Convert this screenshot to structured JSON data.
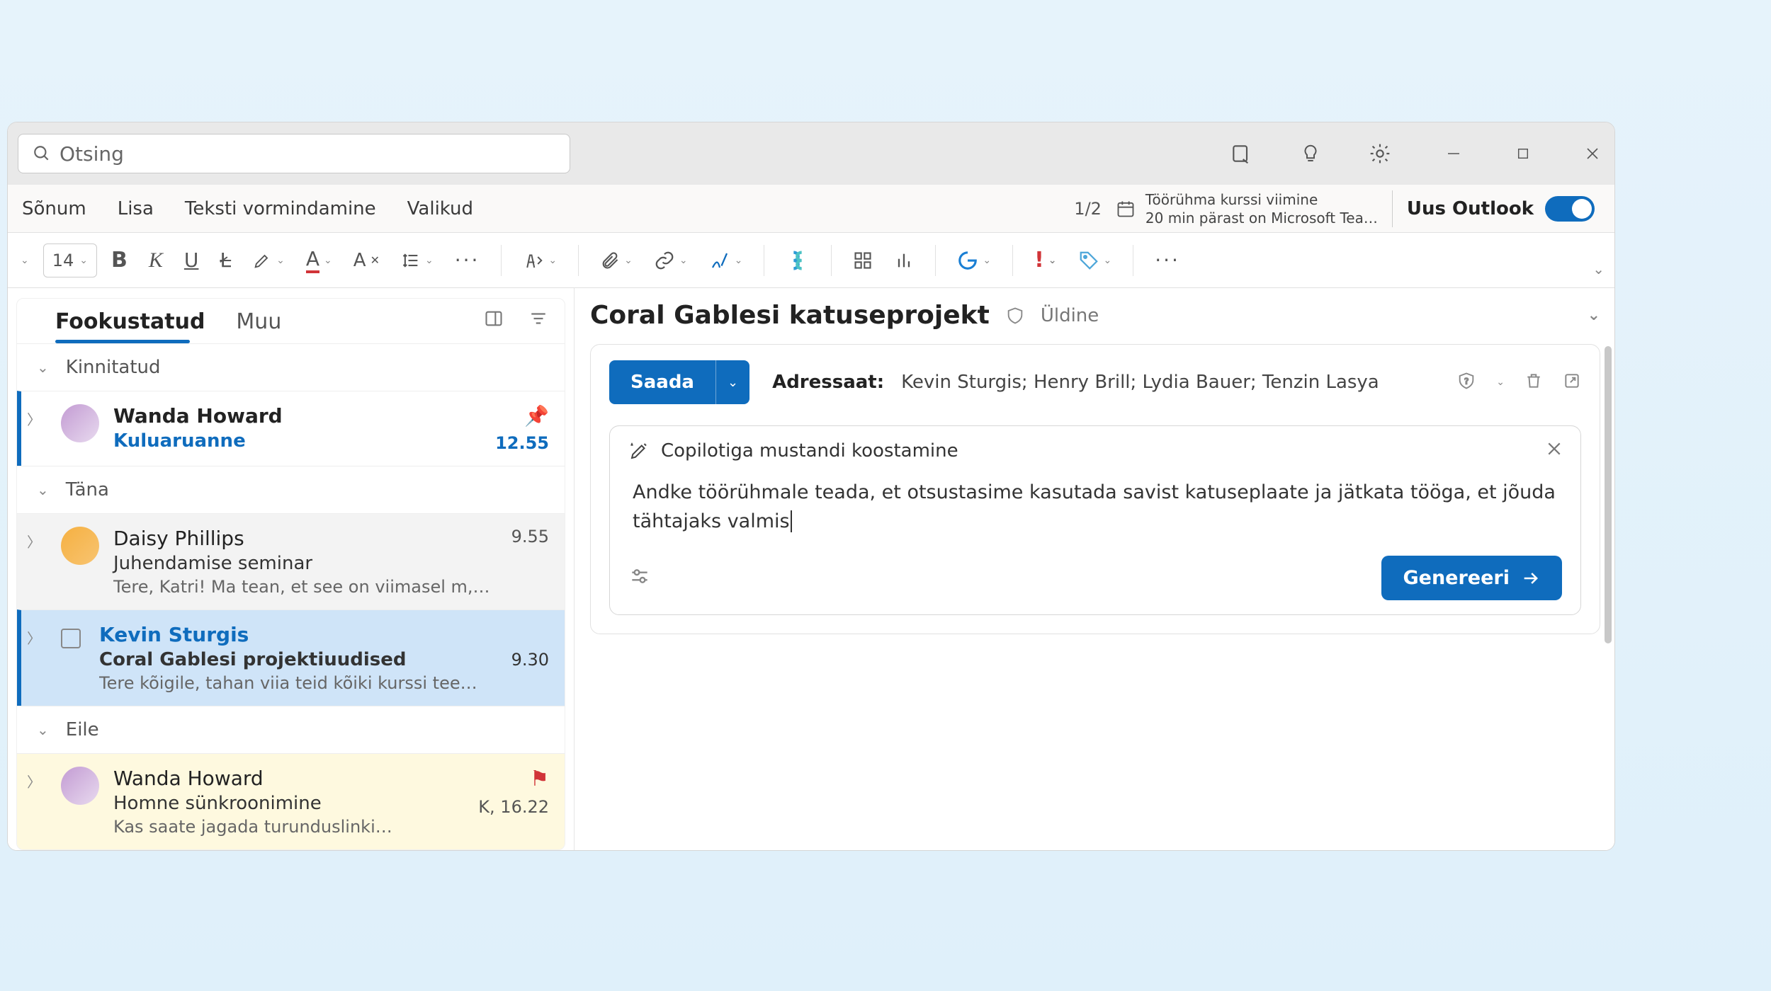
{
  "search": {
    "placeholder": "Otsing"
  },
  "ribbon": {
    "tabs": [
      "Sõnum",
      "Lisa",
      "Teksti vormindamine",
      "Valikud"
    ],
    "counter": "1/2",
    "meeting_title": "Töörühma kurssi viimine",
    "meeting_sub": "20 min pärast on Microsoft Tea…",
    "toggle_label": "Uus Outlook"
  },
  "toolbar": {
    "font_size": "14"
  },
  "list": {
    "tab_focused": "Fookustatud",
    "tab_other": "Muu",
    "group_pinned": "Kinnitatud",
    "group_today": "Täna",
    "group_yesterday": "Eile"
  },
  "mails": {
    "pinned": {
      "sender": "Wanda Howard",
      "subject": "Kuluaruanne",
      "time": "12.55"
    },
    "m1": {
      "sender": "Daisy Phillips",
      "subject": "Juhendamise seminar",
      "preview": "Tere, Katri! Ma tean, et see on viimasel m,…",
      "time": "9.55"
    },
    "m2": {
      "sender": "Kevin Sturgis",
      "subject": "Coral Gablesi projektiuudised",
      "preview": "Tere kõigile, tahan viia teid kõiki kurssi tee…",
      "time": "9.30"
    },
    "m3": {
      "sender": "Wanda Howard",
      "subject": "Homne sünkroonimine",
      "preview": "Kas saate jagada turunduslinki…",
      "time": "K, 16.22"
    }
  },
  "reading": {
    "title": "Coral Gablesi katuseprojekt",
    "label": "Üldine",
    "send": "Saada",
    "to_label": "Adressaat:",
    "to_values": "Kevin Sturgis; Henry Brill; Lydia Bauer; Tenzin Lasya"
  },
  "copilot": {
    "header": "Copilotiga mustandi koostamine",
    "prompt": "Andke töörühmale teada, et otsustasime kasutada savist katuseplaate ja jätkata tööga, et jõuda tähtajaks valmis",
    "generate": "Genereeri"
  }
}
